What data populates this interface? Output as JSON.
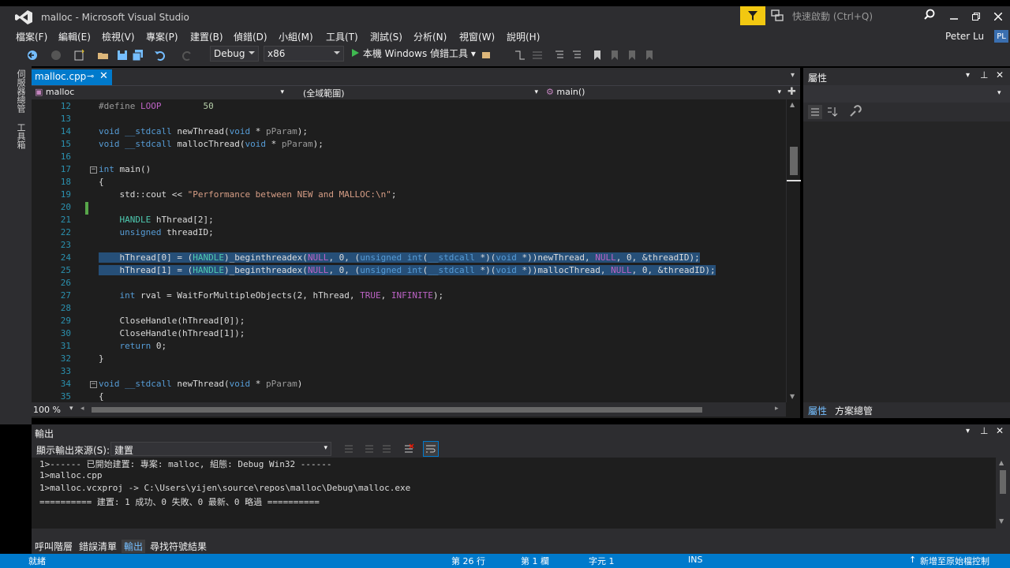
{
  "window": {
    "title": "malloc - Microsoft Visual Studio",
    "quick_launch_placeholder": "快速啟動 (Ctrl+Q)",
    "user_name": "Peter Lu",
    "user_initials": "PL"
  },
  "menu": [
    "檔案(F)",
    "編輯(E)",
    "檢視(V)",
    "專案(P)",
    "建置(B)",
    "偵錯(D)",
    "小組(M)",
    "工具(T)",
    "測試(S)",
    "分析(N)",
    "視窗(W)",
    "說明(H)"
  ],
  "toolbar": {
    "config": "Debug",
    "platform": "x86",
    "run_label": "本機 Windows 偵錯工具"
  },
  "left_strip": {
    "tab1": "伺服器總管",
    "tab2": "工具箱"
  },
  "editor": {
    "tab_label": "malloc.cpp",
    "tab_pin": "⊸",
    "tab_close": "✕",
    "nav_project": "malloc",
    "nav_scope": "(全域範圍)",
    "nav_member": "main()",
    "zoom": "100 %",
    "lines": [
      {
        "n": "12",
        "code": "#define LOOP        50"
      },
      {
        "n": "13",
        "code": ""
      },
      {
        "n": "14",
        "code": "void __stdcall newThread(void * pParam);"
      },
      {
        "n": "15",
        "code": "void __stdcall mallocThread(void * pParam);"
      },
      {
        "n": "16",
        "code": ""
      },
      {
        "n": "17",
        "code": "int main()"
      },
      {
        "n": "18",
        "code": "{"
      },
      {
        "n": "19",
        "code": "    std::cout << \"Performance between NEW and MALLOC:\\n\";"
      },
      {
        "n": "20",
        "code": ""
      },
      {
        "n": "21",
        "code": "    HANDLE hThread[2];"
      },
      {
        "n": "22",
        "code": "    unsigned threadID;"
      },
      {
        "n": "23",
        "code": ""
      },
      {
        "n": "24",
        "code": "    hThread[0] = (HANDLE)_beginthreadex(NULL, 0, (unsigned int(__stdcall *)(void *))newThread, NULL, 0, &threadID);"
      },
      {
        "n": "25",
        "code": "    hThread[1] = (HANDLE)_beginthreadex(NULL, 0, (unsigned int(__stdcall *)(void *))mallocThread, NULL, 0, &threadID);"
      },
      {
        "n": "26",
        "code": ""
      },
      {
        "n": "27",
        "code": "    int rval = WaitForMultipleObjects(2, hThread, TRUE, INFINITE);"
      },
      {
        "n": "28",
        "code": ""
      },
      {
        "n": "29",
        "code": "    CloseHandle(hThread[0]);"
      },
      {
        "n": "30",
        "code": "    CloseHandle(hThread[1]);"
      },
      {
        "n": "31",
        "code": "    return 0;"
      },
      {
        "n": "32",
        "code": "}"
      },
      {
        "n": "33",
        "code": ""
      },
      {
        "n": "34",
        "code": "void __stdcall newThread(void * pParam)"
      },
      {
        "n": "35",
        "code": "{"
      }
    ]
  },
  "properties": {
    "title": "屬性",
    "bottom_tab1": "屬性",
    "bottom_tab2": "方案總管"
  },
  "output": {
    "title": "輸出",
    "source_label": "顯示輸出來源(S):",
    "source_value": "建置",
    "lines": [
      "1>------ 已開始建置: 專案: malloc, 組態: Debug Win32 ------",
      "1>malloc.cpp",
      "1>malloc.vcxproj -> C:\\Users\\yijen\\source\\repos\\malloc\\Debug\\malloc.exe",
      "========== 建置: 1 成功、0 失敗、0 最新、0 略過 =========="
    ]
  },
  "bottom_tabs": [
    "呼叫階層",
    "錯誤清單",
    "輸出",
    "尋找符號結果"
  ],
  "status": {
    "ready": "就緒",
    "line": "第 26 行",
    "col": "第 1 欄",
    "char": "字元 1",
    "ins": "INS",
    "source_control": "新增至原始檔控制"
  },
  "colors": {
    "accent": "#007acc",
    "chrome": "#2d2d30",
    "editor_bg": "#1e1e1e",
    "selection": "#264f78"
  }
}
